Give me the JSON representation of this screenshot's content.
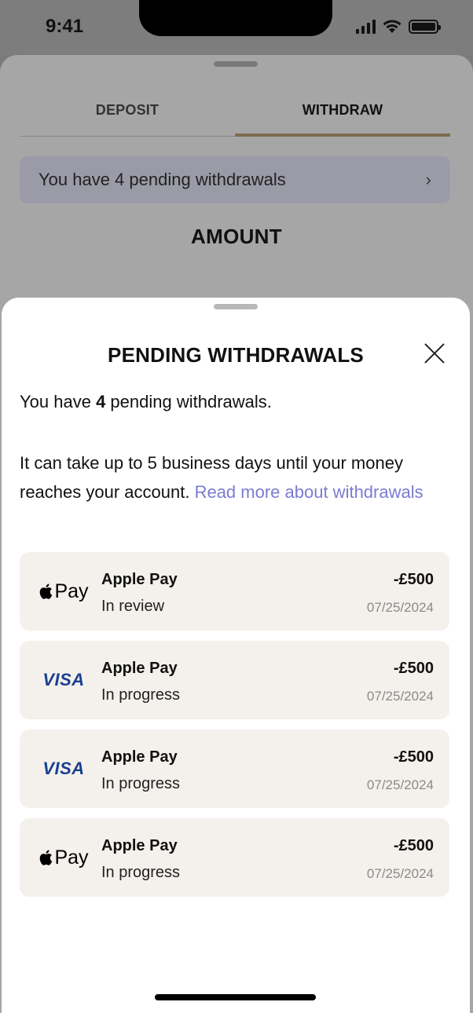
{
  "status_bar": {
    "time": "9:41",
    "icons": [
      "signal-icon",
      "wifi-icon",
      "battery-icon"
    ]
  },
  "background_screen": {
    "tabs": [
      {
        "label": "DEPOSIT",
        "active": false
      },
      {
        "label": "WITHDRAW",
        "active": true
      }
    ],
    "pending_banner": {
      "text": "You have 4 pending withdrawals",
      "icon": "chevron-right-icon"
    },
    "amount_title": "AMOUNT",
    "active_tab_color": "#7d6c4f"
  },
  "modal": {
    "title": "PENDING WITHDRAWALS",
    "close_icon": "close-icon",
    "summary_prefix": "You have ",
    "summary_count": "4",
    "summary_suffix": " pending withdrawals.",
    "info_text": "It can take up to 5 business days until your money reaches your account. ",
    "link_text": "Read more about withdrawals",
    "link_color": "#7b7bd0",
    "withdrawals": [
      {
        "logo": "apple-pay-logo",
        "logo_text": "Pay",
        "method": "Apple Pay",
        "status": "In review",
        "amount": "-£500",
        "date": "07/25/2024"
      },
      {
        "logo": "visa-logo",
        "logo_text": "VISA",
        "method": "Apple Pay",
        "status": "In progress",
        "amount": "-£500",
        "date": "07/25/2024"
      },
      {
        "logo": "visa-logo",
        "logo_text": "VISA",
        "method": "Apple Pay",
        "status": "In progress",
        "amount": "-£500",
        "date": "07/25/2024"
      },
      {
        "logo": "apple-pay-logo",
        "logo_text": "Pay",
        "method": "Apple Pay",
        "status": "In progress",
        "amount": "-£500",
        "date": "07/25/2024"
      }
    ]
  }
}
